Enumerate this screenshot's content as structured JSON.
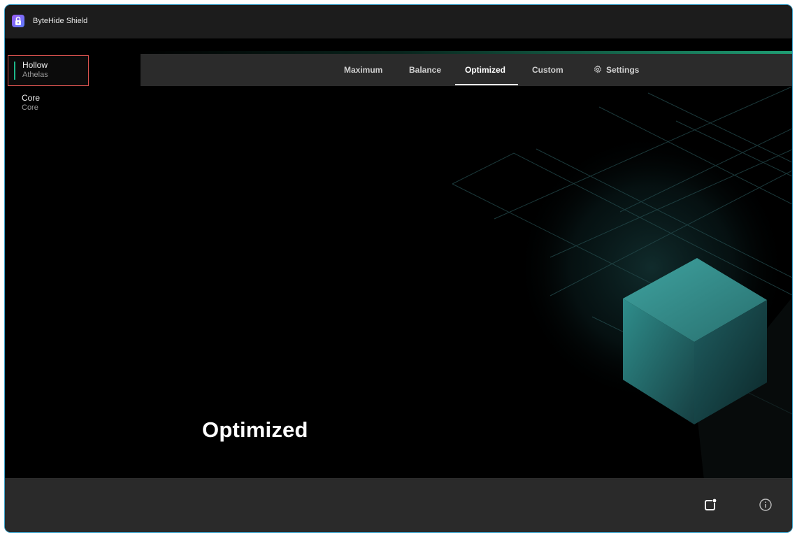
{
  "app": {
    "title": "ByteHide Shield"
  },
  "sidebar": {
    "items": [
      {
        "title": "Hollow",
        "subtitle": "Athelas",
        "selected": true
      },
      {
        "title": "Core",
        "subtitle": "Core",
        "selected": false
      }
    ]
  },
  "tabs": [
    {
      "label": "Maximum",
      "active": false
    },
    {
      "label": "Balance",
      "active": false
    },
    {
      "label": "Optimized",
      "active": true
    },
    {
      "label": "Custom",
      "active": false
    },
    {
      "label": "Settings",
      "icon": "gear-icon",
      "active": false
    }
  ],
  "hero": {
    "title": "Optimized"
  },
  "footer": {
    "buttons": [
      "notification-icon",
      "info-icon"
    ]
  },
  "colors": {
    "accent": "#1f9e74",
    "selection_border": "#d9534f",
    "window_border": "#3aa0c8",
    "cube": "#2a7f80"
  }
}
